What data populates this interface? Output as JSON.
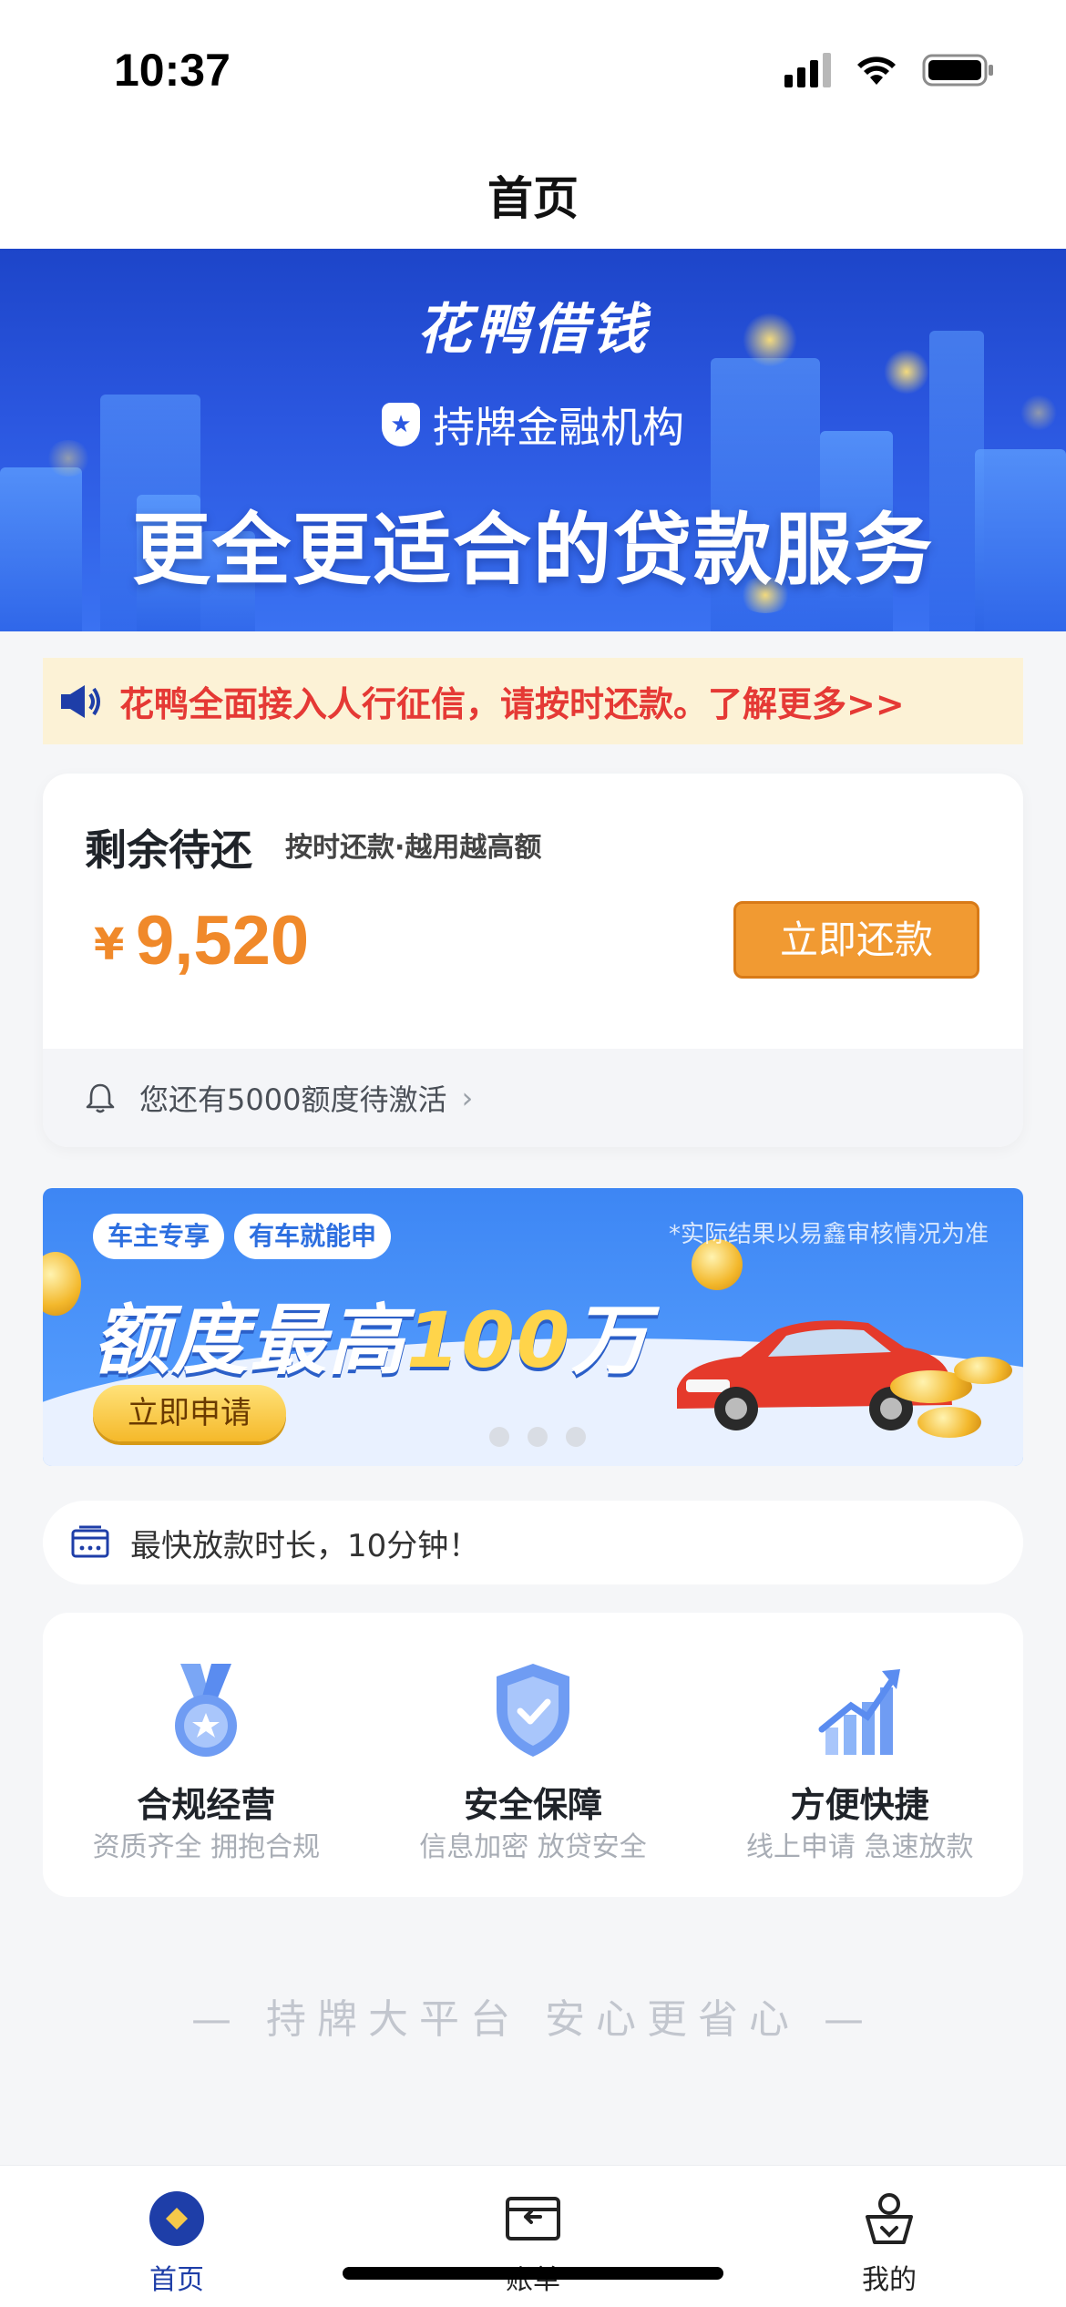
{
  "status_bar": {
    "time": "10:37"
  },
  "nav": {
    "title": "首页"
  },
  "hero": {
    "brand": "花鸭借钱",
    "license": "持牌金融机构",
    "slogan": "更全更适合的贷款服务"
  },
  "notice": {
    "text": "花鸭全面接入人行征信，请按时还款。了解更多>>"
  },
  "repay": {
    "label": "剩余待还",
    "subtitle": "按时还款·越用越高额",
    "currency": "¥",
    "amount": "9,520",
    "button": "立即还款",
    "footer": "您还有5000额度待激活"
  },
  "promo": {
    "tags": [
      "车主专享",
      "有车就能申"
    ],
    "note": "*实际结果以易鑫审核情况为准",
    "title_prefix": "额度最高",
    "title_highlight": "100",
    "title_suffix": "万",
    "button": "立即申请",
    "carousel_total": 3
  },
  "info": {
    "text": "最快放款时长，10分钟！"
  },
  "features": [
    {
      "title": "合规经营",
      "desc": "资质齐全 拥抱合规",
      "icon": "medal-icon"
    },
    {
      "title": "安全保障",
      "desc": "信息加密 放贷安全",
      "icon": "shield-check-icon"
    },
    {
      "title": "方便快捷",
      "desc": "线上申请 急速放款",
      "icon": "growth-chart-icon"
    }
  ],
  "slogan": "— 持牌大平台 安心更省心 —",
  "tabs": [
    {
      "label": "首页",
      "icon": "home-diamond-icon",
      "active": true
    },
    {
      "label": "账单",
      "icon": "bill-wallet-icon",
      "active": false
    },
    {
      "label": "我的",
      "icon": "profile-icon",
      "active": false
    }
  ],
  "colors": {
    "brand_blue": "#2b57e0",
    "accent_orange": "#f0892a",
    "notice_red": "#e53935",
    "tab_active": "#1e3ea8"
  }
}
